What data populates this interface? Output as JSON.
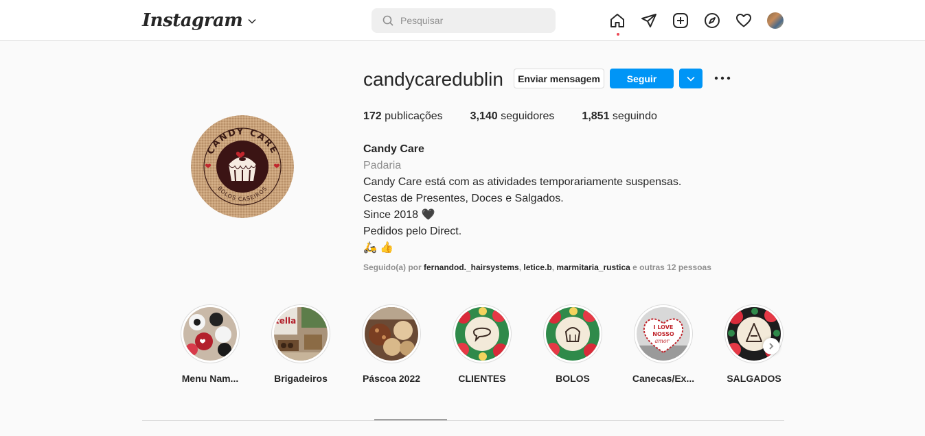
{
  "topbar": {
    "logo": "Instagram",
    "search_placeholder": "Pesquisar",
    "icons": [
      "home-icon",
      "direct-icon",
      "new-post-icon",
      "explore-icon",
      "activity-heart-icon"
    ],
    "notification_dot_color": "#ed4956"
  },
  "profile": {
    "username": "candycaredublin",
    "message_button": "Enviar mensagem",
    "follow_button": "Seguir",
    "stats": {
      "posts_count": "172",
      "posts_label": " publicações",
      "followers_count": "3,140",
      "followers_label": " seguidores",
      "following_count": "1,851",
      "following_label": " seguindo"
    },
    "avatar_text_top": "CANDY CARE",
    "avatar_text_bottom": "BOLOS CASEIROS",
    "bio": {
      "name": "Candy Care",
      "category": "Padaria",
      "lines": [
        "Candy Care está com as atividades temporariamente suspensas.",
        "Cestas de Presentes, Doces e Salgados.",
        "Since 2018 🖤",
        "Pedidos pelo Direct.",
        "🛵 👍"
      ]
    },
    "followed_by": {
      "prefix": "Seguido(a) por ",
      "accounts": [
        "fernandod._hairsystems",
        "letice.b",
        "marmitaria_rustica"
      ],
      "separator": ", ",
      "suffix": " e outras 12 pessoas"
    }
  },
  "highlights": [
    {
      "label": "Menu Nam..."
    },
    {
      "label": "Brigadeiros"
    },
    {
      "label": "Páscoa 2022"
    },
    {
      "label": "CLIENTES"
    },
    {
      "label": "BOLOS"
    },
    {
      "label": "Canecas/Ex..."
    },
    {
      "label": "SALGADOS"
    }
  ],
  "highlight_art_text": [
    "I LOVE",
    "NOSSO",
    "amor",
    "tella"
  ],
  "colors": {
    "accent": "#0095f6",
    "text": "#262626",
    "secondary_text": "#8e8e8e",
    "border": "#dbdbdb",
    "background": "#fafafa"
  }
}
